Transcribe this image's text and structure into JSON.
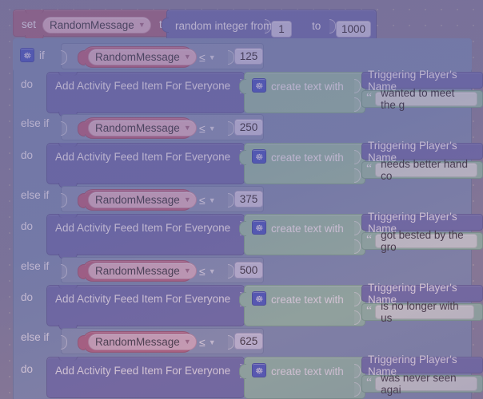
{
  "canvas": {
    "background_color": "#7b7b94",
    "grid_dot_color": "#96969e",
    "grid_spacing_px": 20
  },
  "palette": {
    "variable_set_block": "#a05a72",
    "variable_get_block": "#b9546f",
    "variable_field_pill": "#e8b9c6",
    "math_block": "#5b63a8",
    "logic_if_block": "#6f8ab0",
    "logic_if_row": "#7c93b5",
    "text_join_block": "#8cc3a2",
    "text_field": "#dbe8de",
    "number_field": "#cfd2ea",
    "gear_icon": "#2b47c4"
  },
  "icons": {
    "gear": "gear-icon",
    "dropdown_caret": "chevron-down-icon",
    "quote": "quote-mark-icon"
  },
  "set_block": {
    "keyword": "set",
    "variable": "RandomMessage",
    "to_label": "to",
    "value_block": {
      "label": "random integer from",
      "from": "1",
      "to_label": "to",
      "to": "1000"
    }
  },
  "if_block": {
    "if_label": "if",
    "else_if_label": "else if",
    "do_label": "do",
    "branches": [
      {
        "condition": {
          "variable": "RandomMessage",
          "operator": "≤",
          "value": "125"
        },
        "statement": {
          "label": "Add Activity Feed Item For Everyone",
          "join_label": "create text with",
          "items": [
            "Triggering Player's Name",
            "wanted to meet the g"
          ]
        }
      },
      {
        "condition": {
          "variable": "RandomMessage",
          "operator": "≤",
          "value": "250"
        },
        "statement": {
          "label": "Add Activity Feed Item For Everyone",
          "join_label": "create text with",
          "items": [
            "Triggering Player's Name",
            "needs better hand co"
          ]
        }
      },
      {
        "condition": {
          "variable": "RandomMessage",
          "operator": "≤",
          "value": "375"
        },
        "statement": {
          "label": "Add Activity Feed Item For Everyone",
          "join_label": "create text with",
          "items": [
            "Triggering Player's Name",
            "got bested by the gro"
          ]
        }
      },
      {
        "condition": {
          "variable": "RandomMessage",
          "operator": "≤",
          "value": "500"
        },
        "statement": {
          "label": "Add Activity Feed Item For Everyone",
          "join_label": "create text with",
          "items": [
            "Triggering Player's Name",
            "is no longer with us"
          ]
        }
      },
      {
        "condition": {
          "variable": "RandomMessage",
          "operator": "≤",
          "value": "625"
        },
        "statement": {
          "label": "Add Activity Feed Item For Everyone",
          "join_label": "create text with",
          "items": [
            "Triggering Player's Name",
            "was never seen agai"
          ]
        }
      }
    ]
  }
}
